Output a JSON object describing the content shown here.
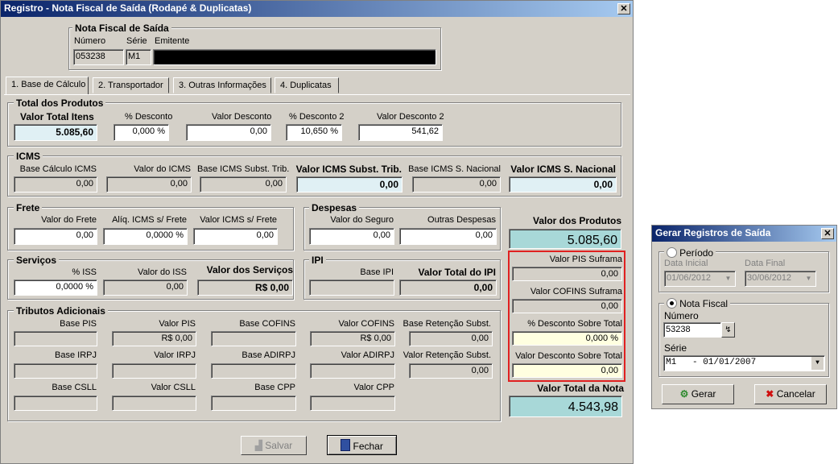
{
  "main": {
    "title": "Registro - Nota Fiscal de Saída (Rodapé & Duplicatas)",
    "nf": {
      "group_title": "Nota Fiscal de Saída",
      "numero_label": "Número",
      "serie_label": "Série",
      "emitente_label": "Emitente",
      "numero": "053238",
      "serie": "M1",
      "emitente": ""
    },
    "tabs": [
      "1. Base de Cálculo",
      "2. Transportador",
      "3. Outras Informações",
      "4. Duplicatas"
    ],
    "produtos": {
      "title": "Total dos Produtos",
      "valor_total_itens_label": "Valor Total Itens",
      "valor_total_itens": "5.085,60",
      "pct_desconto_label": "% Desconto",
      "pct_desconto": "0,000 %",
      "valor_desconto_label": "Valor Desconto",
      "valor_desconto": "0,00",
      "pct_desconto2_label": "% Desconto 2",
      "pct_desconto2": "10,650 %",
      "valor_desconto2_label": "Valor Desconto 2",
      "valor_desconto2": "541,62"
    },
    "icms": {
      "title": "ICMS",
      "base_calc_label": "Base Cálculo ICMS",
      "base_calc": "0,00",
      "valor_icms_label": "Valor do ICMS",
      "valor_icms": "0,00",
      "base_subst_label": "Base ICMS Subst. Trib.",
      "base_subst": "0,00",
      "valor_subst_label": "Valor ICMS Subst. Trib.",
      "valor_subst": "0,00",
      "base_snac_label": "Base ICMS S. Nacional",
      "base_snac": "0,00",
      "valor_snac_label": "Valor ICMS S. Nacional",
      "valor_snac": "0,00"
    },
    "frete": {
      "title": "Frete",
      "valor_frete_label": "Valor do Frete",
      "valor_frete": "0,00",
      "aliq_label": "Alíq. ICMS s/ Frete",
      "aliq": "0,0000 %",
      "valor_icms_label": "Valor ICMS s/ Frete",
      "valor_icms": "0,00"
    },
    "despesas": {
      "title": "Despesas",
      "seguro_label": "Valor do Seguro",
      "seguro": "0,00",
      "outras_label": "Outras Despesas",
      "outras": "0,00"
    },
    "servicos": {
      "title": "Serviços",
      "pct_iss_label": "% ISS",
      "pct_iss": "0,0000 %",
      "valor_iss_label": "Valor do ISS",
      "valor_iss": "0,00",
      "valor_servicos_label": "Valor dos Serviços",
      "valor_servicos": "R$ 0,00"
    },
    "ipi": {
      "title": "IPI",
      "base_label": "Base IPI",
      "base": "",
      "total_label": "Valor Total do IPI",
      "total": "0,00"
    },
    "tributos": {
      "title": "Tributos Adicionais",
      "base_pis_label": "Base PIS",
      "base_pis": "",
      "valor_pis_label": "Valor PIS",
      "valor_pis": "R$ 0,00",
      "base_cofins_label": "Base COFINS",
      "base_cofins": "",
      "valor_cofins_label": "Valor COFINS",
      "valor_cofins": "R$ 0,00",
      "base_ret_label": "Base Retenção Subst.",
      "base_ret": "0,00",
      "base_irpj_label": "Base IRPJ",
      "base_irpj": "",
      "valor_irpj_label": "Valor IRPJ",
      "valor_irpj": "",
      "base_adirpj_label": "Base ADIRPJ",
      "base_adirpj": "",
      "valor_adirpj_label": "Valor ADIRPJ",
      "valor_adirpj": "",
      "valor_ret_label": "Valor Retenção Subst.",
      "valor_ret": "0,00",
      "base_csll_label": "Base CSLL",
      "base_csll": "",
      "valor_csll_label": "Valor CSLL",
      "valor_csll": "",
      "base_cpp_label": "Base CPP",
      "base_cpp": "",
      "valor_cpp_label": "Valor CPP",
      "valor_cpp": ""
    },
    "valor_produtos_label": "Valor dos Produtos",
    "valor_produtos": "5.085,60",
    "suframa": {
      "pis_label": "Valor PIS Suframa",
      "pis": "0,00",
      "cofins_label": "Valor COFINS Suframa",
      "cofins": "0,00",
      "pct_desc_label": "% Desconto Sobre Total",
      "pct_desc": "0,000 %",
      "valor_desc_label": "Valor Desconto Sobre Total",
      "valor_desc": "0,00"
    },
    "valor_total_nota_label": "Valor Total da Nota",
    "valor_total_nota": "4.543,98",
    "salvar_label": "Salvar",
    "fechar_label": "Fechar"
  },
  "dialog": {
    "title": "Gerar Registros de Saída",
    "periodo_label": "Período",
    "data_inicial_label": "Data Inicial",
    "data_inicial": "01/06/2012",
    "data_final_label": "Data Final",
    "data_final": "30/06/2012",
    "nota_fiscal_label": "Nota Fiscal",
    "numero_label": "Número",
    "numero": "53238",
    "serie_label": "Série",
    "serie": "M1   - 01/01/2007",
    "gerar_label": "Gerar",
    "cancelar_label": "Cancelar"
  }
}
